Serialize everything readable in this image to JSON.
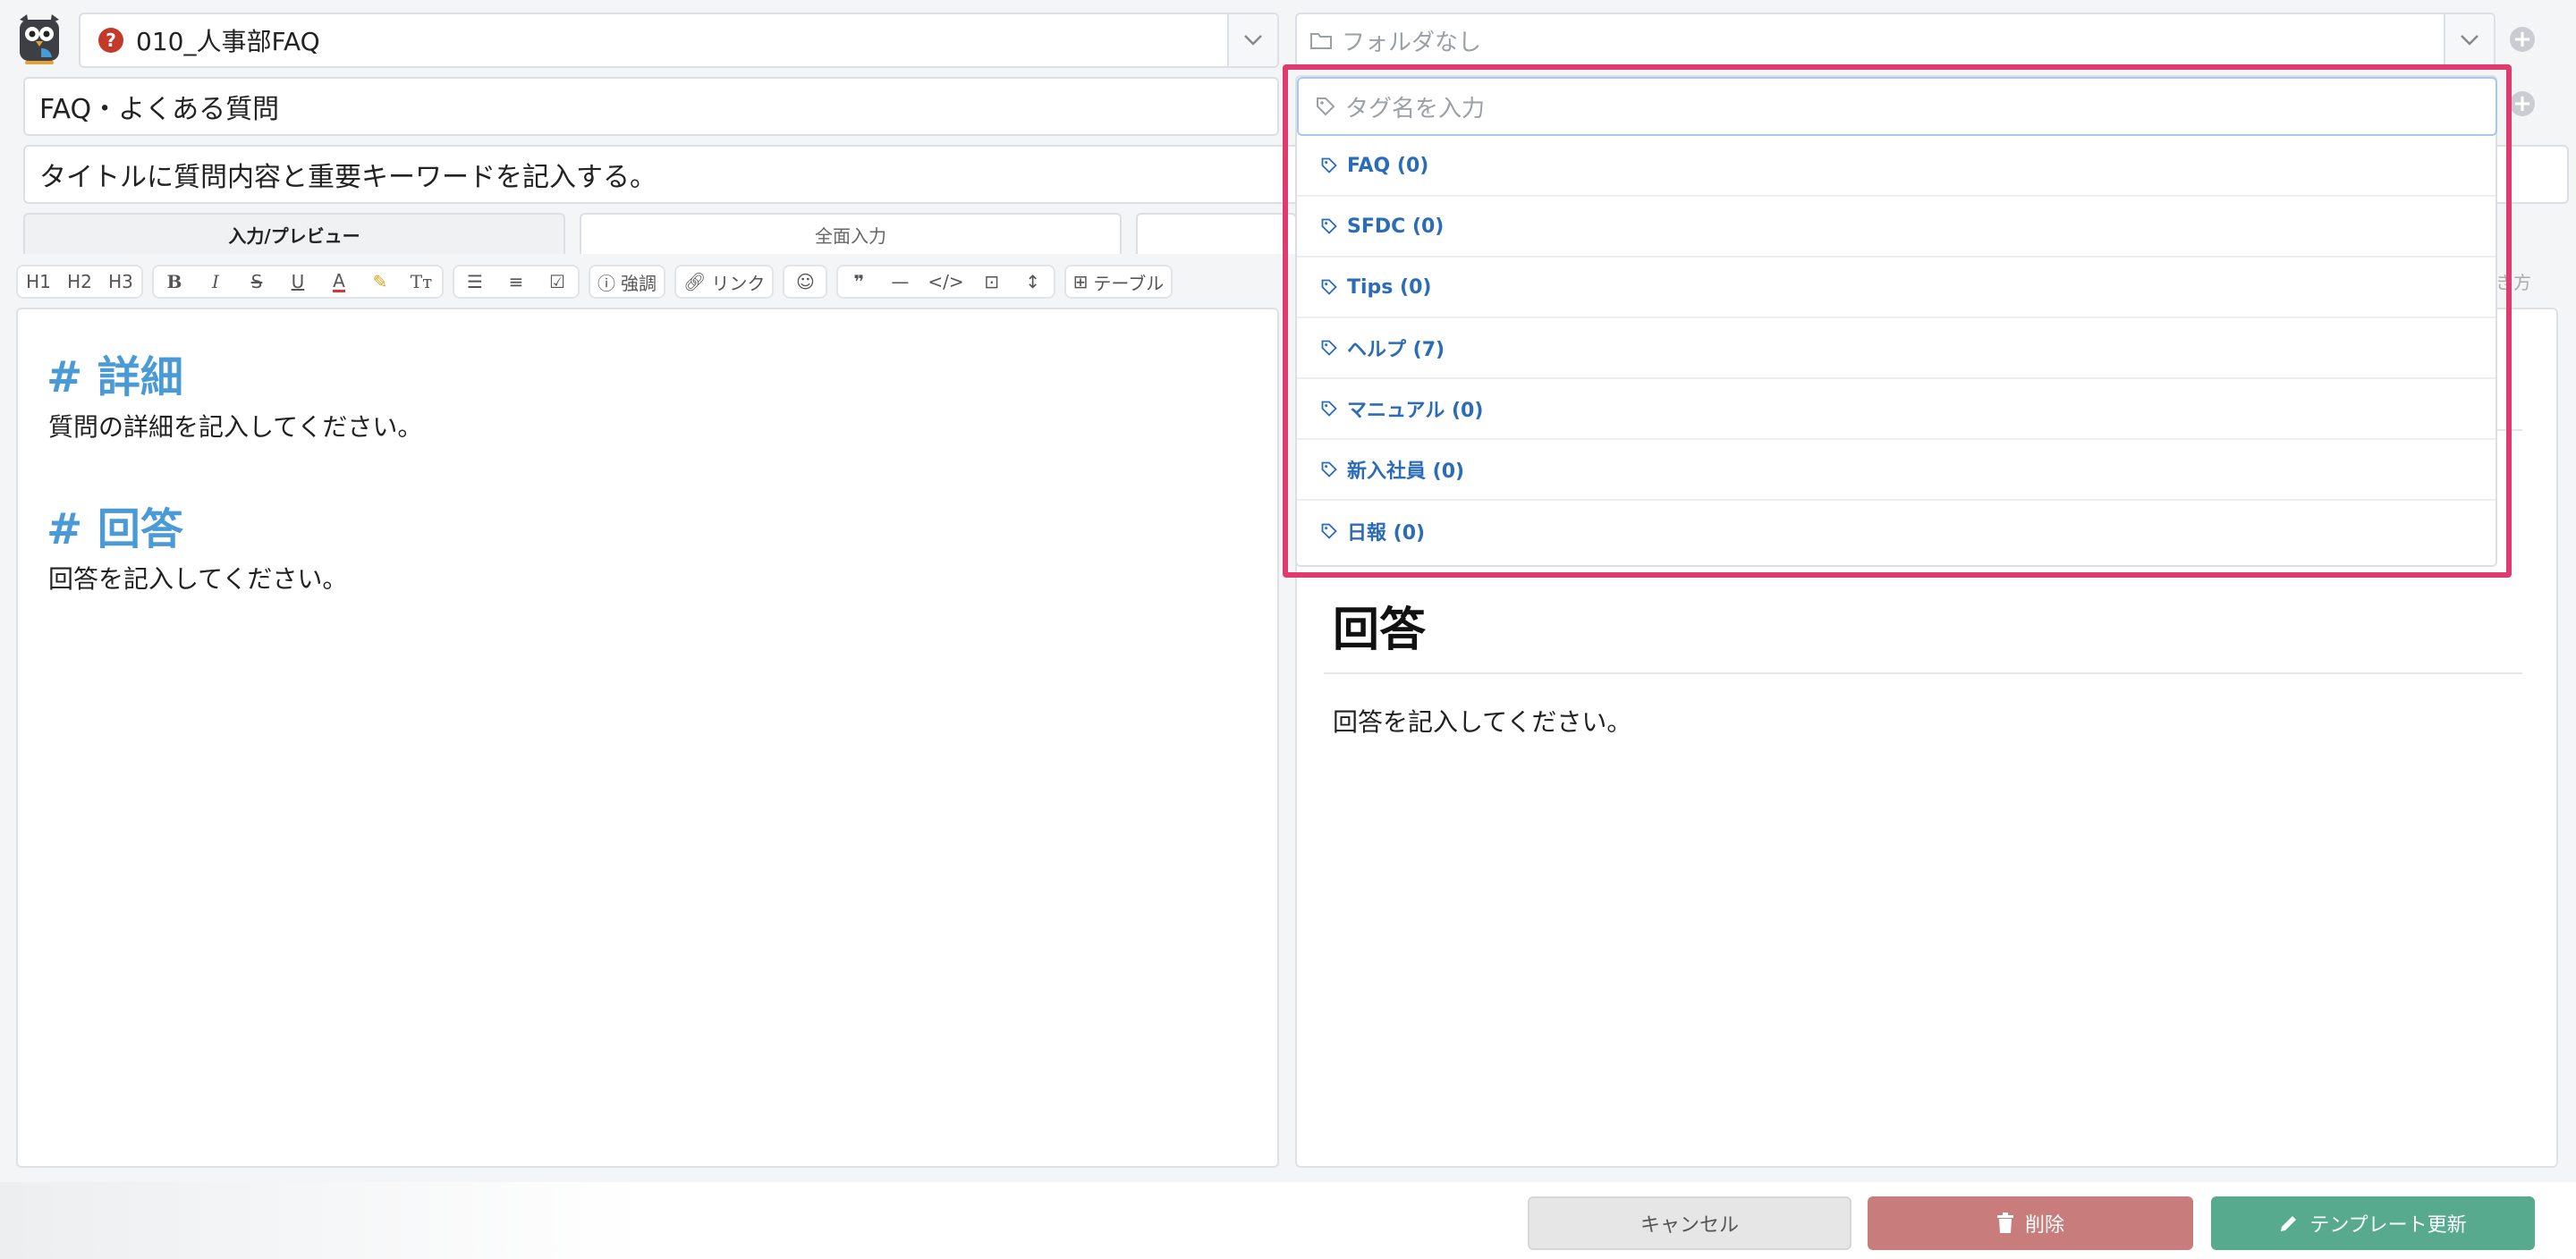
{
  "header": {
    "faq_select": "010_人事部FAQ",
    "folder_select_placeholder": "フォルダなし"
  },
  "form": {
    "title_value": "FAQ・よくある質問",
    "description_value": "タイトルに質問内容と重要キーワードを記入する。"
  },
  "tabs": [
    {
      "label": "入力/プレビュー",
      "active": true
    },
    {
      "label": "全面入力",
      "active": false
    }
  ],
  "toolbar": {
    "h1": "H1",
    "h2": "H2",
    "h3": "H3",
    "emphasis": "強調",
    "link": "リンク",
    "table": "テーブル",
    "reading": "き方"
  },
  "editor": {
    "h_detail": "# 詳細",
    "p_detail": "質問の詳細を記入してください。",
    "h_answer": "# 回答",
    "p_answer": "回答を記入してください。"
  },
  "preview": {
    "h_answer": "回答",
    "p_answer": "回答を記入してください。"
  },
  "tag_dropdown": {
    "placeholder": "タグ名を入力",
    "items": [
      {
        "label": "FAQ (0)"
      },
      {
        "label": "SFDC (0)"
      },
      {
        "label": "Tips (0)"
      },
      {
        "label": "ヘルプ (7)"
      },
      {
        "label": "マニュアル (0)"
      },
      {
        "label": "新入社員 (0)"
      },
      {
        "label": "日報 (0)"
      }
    ]
  },
  "footer": {
    "cancel": "キャンセル",
    "delete": "削除",
    "update": "テンプレート更新"
  },
  "colors": {
    "accent_highlight": "#e03a6e",
    "tag_link": "#2b6cb8",
    "markdown_heading": "#4a9ad6",
    "delete": "#c97c7c",
    "update": "#58aa8e"
  }
}
